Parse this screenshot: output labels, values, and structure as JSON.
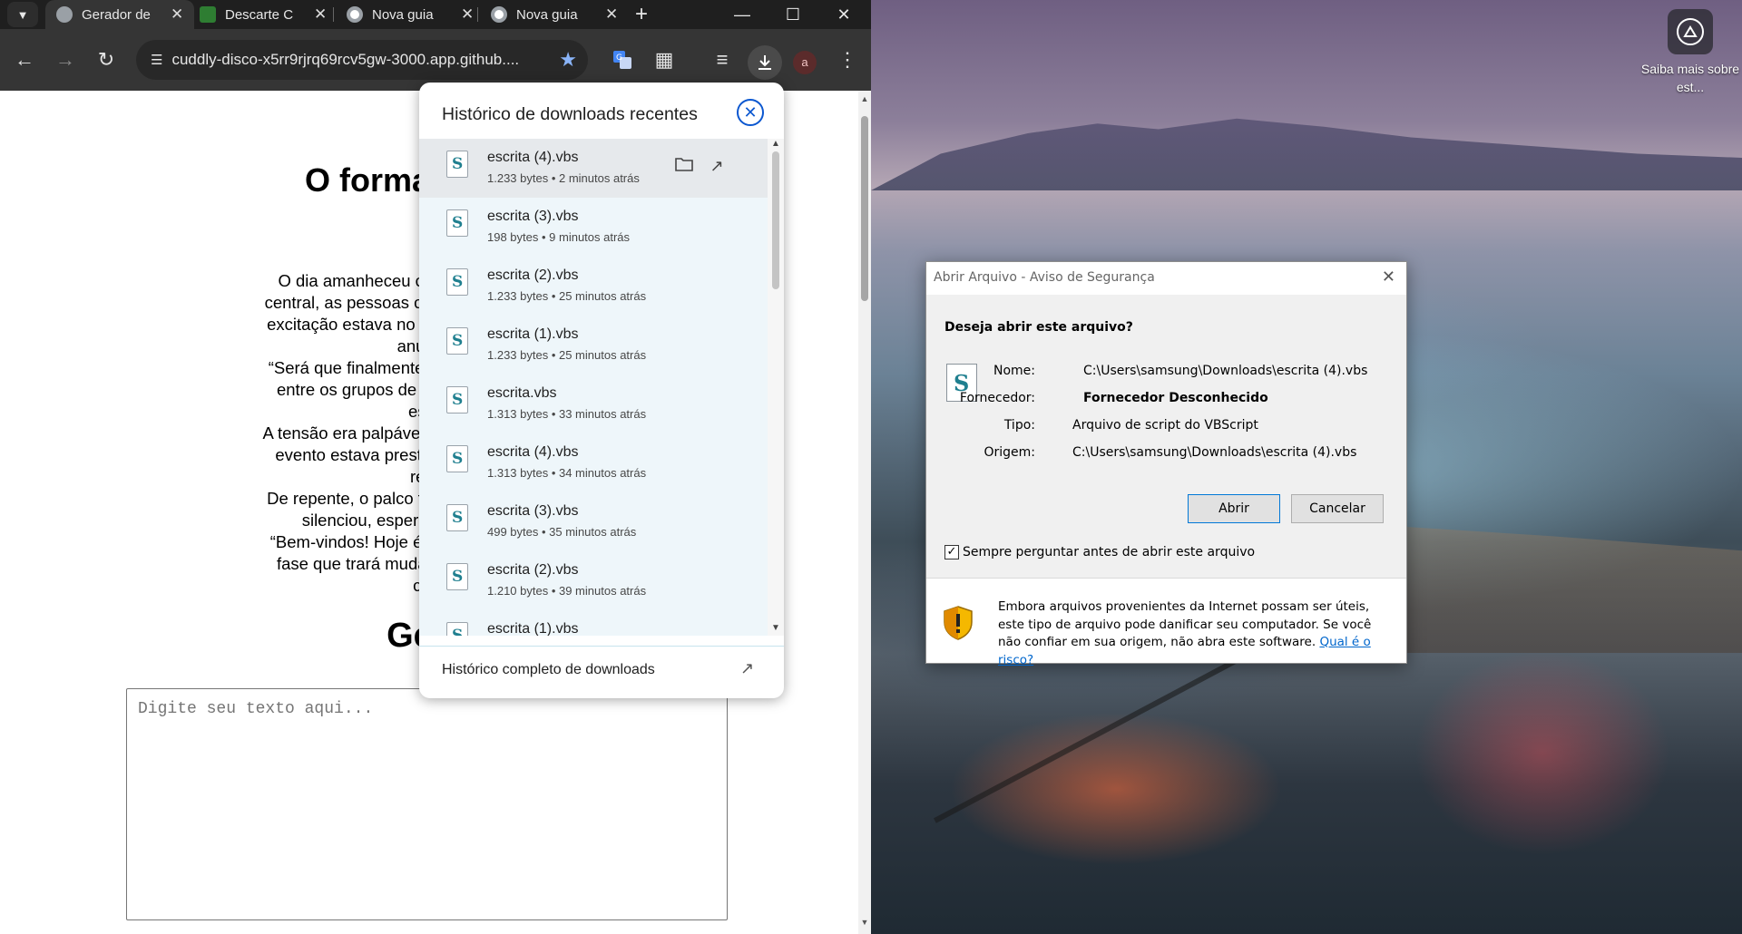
{
  "browser": {
    "tabs": [
      {
        "title": "Gerador de",
        "active": true
      },
      {
        "title": "Descarte C",
        "active": false
      },
      {
        "title": "Nova guia",
        "active": false
      },
      {
        "title": "Nova guia",
        "active": false
      }
    ],
    "url": "cuddly-disco-x5rr9rjrq69rcv5gw-3000.app.github....",
    "profile_initial": "a"
  },
  "page": {
    "heading_line1": "O formato que eu v",
    "heading_line2": "ac",
    "story_lines": [
      "O dia amanheceu claro, e a brisa suave",
      "central, as pessoas começavam a se reunir",
      "excitação estava no ar, e todos esperavam",
      "anúncio",
      "“Será que finalmente teremos boas notícia",
      "entre os grupos de amigos. “Espero que",
      "espe",
      "A tensão era palpável, e, ao longe, podia-se",
      "evento estava prestes a começar, e todo",
      "rese",
      "De repente, o palco foi iluminado e uma fig",
      "silenciou, esperando ansiosamen",
      "“Bem-vindos! Hoje é um dia histórico para",
      "fase que trará mudanças significativas p",
      "con"
    ],
    "generator_heading": "Gerador",
    "textarea_placeholder": "Digite seu texto aqui..."
  },
  "downloads": {
    "title": "Histórico de downloads recentes",
    "items": [
      {
        "name": "escrita (4).vbs",
        "meta": "1.233 bytes • 2 minutos atrás"
      },
      {
        "name": "escrita (3).vbs",
        "meta": "198 bytes • 9 minutos atrás"
      },
      {
        "name": "escrita (2).vbs",
        "meta": "1.233 bytes • 25 minutos atrás"
      },
      {
        "name": "escrita (1).vbs",
        "meta": "1.233 bytes • 25 minutos atrás"
      },
      {
        "name": "escrita.vbs",
        "meta": "1.313 bytes • 33 minutos atrás"
      },
      {
        "name": "escrita (4).vbs",
        "meta": "1.313 bytes • 34 minutos atrás"
      },
      {
        "name": "escrita (3).vbs",
        "meta": "499 bytes • 35 minutos atrás"
      },
      {
        "name": "escrita (2).vbs",
        "meta": "1.210 bytes • 39 minutos atrás"
      },
      {
        "name": "escrita (1).vbs",
        "meta": ""
      }
    ],
    "footer": "Histórico completo de downloads"
  },
  "dialog": {
    "title": "Abrir Arquivo - Aviso de Segurança",
    "question": "Deseja abrir este arquivo?",
    "labels": {
      "name": "Nome:",
      "vendor": "Fornecedor:",
      "type": "Tipo:",
      "origin": "Origem:"
    },
    "values": {
      "name": "C:\\Users\\samsung\\Downloads\\escrita (4).vbs",
      "vendor": "Fornecedor Desconhecido",
      "type": "Arquivo de script do VBScript",
      "origin": "C:\\Users\\samsung\\Downloads\\escrita (4).vbs"
    },
    "open_button": "Abrir",
    "cancel_button": "Cancelar",
    "checkbox_label": "Sempre perguntar antes de abrir este arquivo",
    "warning_text": "Embora arquivos provenientes da Internet possam ser úteis, este tipo de arquivo pode danificar seu computador. Se você não confiar em sua origem, não abra este software. ",
    "risk_link": "Qual é o risco?"
  },
  "desktop": {
    "learn_more": "Saiba mais sobre est..."
  },
  "colors": {
    "browser_frame": "#1f1f1f",
    "toolbar": "#353535",
    "accent_blue": "#0b57d0",
    "download_list_bg": "#eef6fa"
  }
}
